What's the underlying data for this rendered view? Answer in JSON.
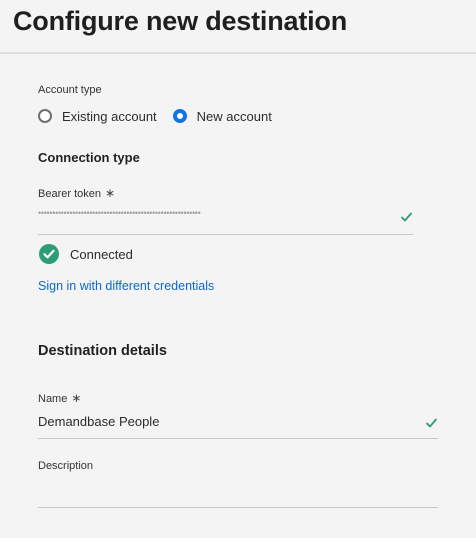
{
  "page": {
    "title": "Configure new destination"
  },
  "account": {
    "label": "Account type",
    "options": [
      {
        "label": "Existing account",
        "selected": false
      },
      {
        "label": "New account",
        "selected": true
      }
    ]
  },
  "connection": {
    "heading": "Connection type",
    "token_label": "Bearer token",
    "required_mark": "∗",
    "token_value": "•••••••••••••••••••••••••••••••••••••••••••••••••••••••••",
    "status": "Connected",
    "signin_link": "Sign in with different credentials"
  },
  "details": {
    "heading": "Destination details",
    "name_label": "Name",
    "required_mark": "∗",
    "name_value": "Demandbase People",
    "description_label": "Description",
    "description_value": ""
  },
  "colors": {
    "accent": "#1473e6",
    "link": "#0d66d0",
    "success": "#2d9d78"
  },
  "icons": [
    "radio-unselected",
    "radio-selected",
    "checkmark-icon",
    "check-circle-icon"
  ]
}
